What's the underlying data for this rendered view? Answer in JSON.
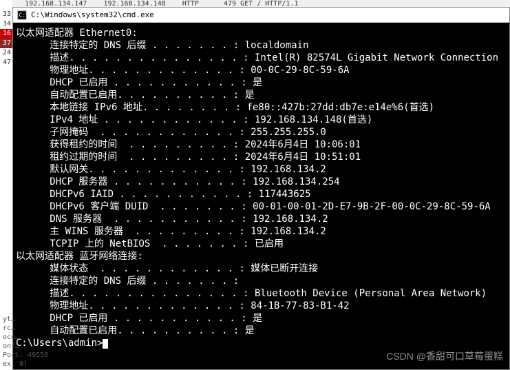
{
  "background": {
    "top_row": "   192.168.134.147    192.168.134.148    HTTP      479 GET / HTTP/1.1",
    "line_numbers": [
      "",
      "33",
      "34",
      "16",
      "37",
      "24",
      "47"
    ],
    "bottom_lines": [
      "yt…",
      "rc…",
      "oco…",
      "onf…",
      "",
      "Port: 49556",
      "ex: 0]"
    ]
  },
  "window": {
    "title": "C:\\Windows\\system32\\cmd.exe"
  },
  "terminal": {
    "adapter1_header": "以太网适配器 Ethernet0:",
    "adapter1": [
      {
        "label": "连接特定的 DNS 后缀",
        "dots": " . . . . . . . :",
        "value": " localdomain"
      },
      {
        "label": "描述",
        "dots": ". . . . . . . . . . . . . . . :",
        "value": " Intel(R) 82574L Gigabit Network Connection"
      },
      {
        "label": "物理地址",
        "dots": ". . . . . . . . . . . . . :",
        "value": " 00-0C-29-8C-59-6A"
      },
      {
        "label": "DHCP 已启用",
        "dots": " . . . . . . . . . . . :",
        "value": " 是"
      },
      {
        "label": "自动配置已启用",
        "dots": ". . . . . . . . . . :",
        "value": " 是"
      },
      {
        "label": "本地链接 IPv6 地址",
        "dots": ". . . . . . . . :",
        "value": " fe80::427b:27dd:db7e:e14e%6(首选)"
      },
      {
        "label": "IPv4 地址",
        "dots": " . . . . . . . . . . . . :",
        "value": " 192.168.134.148(首选)"
      },
      {
        "label": "子网掩码",
        "dots": "  . . . . . . . . . . . . :",
        "value": " 255.255.255.0"
      },
      {
        "label": "获得租约的时间",
        "dots": "  . . . . . . . . . :",
        "value": " 2024年6月4日 10:06:01"
      },
      {
        "label": "租约过期的时间",
        "dots": "  . . . . . . . . . :",
        "value": " 2024年6月4日 10:51:01"
      },
      {
        "label": "默认网关",
        "dots": ". . . . . . . . . . . . . :",
        "value": " 192.168.134.2"
      },
      {
        "label": "DHCP 服务器",
        "dots": " . . . . . . . . . . . :",
        "value": " 192.168.134.254"
      },
      {
        "label": "DHCPv6 IAID",
        "dots": " . . . . . . . . . . . :",
        "value": " 117443625"
      },
      {
        "label": "DHCPv6 客户端 DUID",
        "dots": "  . . . . . . . :",
        "value": " 00-01-00-01-2D-E7-9B-2F-00-0C-29-8C-59-6A"
      },
      {
        "label": "DNS 服务器",
        "dots": "  . . . . . . . . . . . :",
        "value": " 192.168.134.2"
      },
      {
        "label": "主 WINS 服务器",
        "dots": "  . . . . . . . . . :",
        "value": " 192.168.134.2"
      },
      {
        "label": "TCPIP 上的 NetBIOS",
        "dots": "  . . . . . . . :",
        "value": " 已启用"
      }
    ],
    "adapter2_header": "以太网适配器 蓝牙网络连接:",
    "adapter2": [
      {
        "label": "媒体状态",
        "dots": "  . . . . . . . . . . . . :",
        "value": " 媒体已断开连接"
      },
      {
        "label": "连接特定的 DNS 后缀",
        "dots": " . . . . . . . :",
        "value": ""
      },
      {
        "label": "描述",
        "dots": ". . . . . . . . . . . . . . . :",
        "value": " Bluetooth Device (Personal Area Network)"
      },
      {
        "label": "物理地址",
        "dots": ". . . . . . . . . . . . . :",
        "value": " 84-1B-77-83-B1-42"
      },
      {
        "label": "DHCP 已启用",
        "dots": " . . . . . . . . . . . :",
        "value": " 是"
      },
      {
        "label": "自动配置已启用",
        "dots": ". . . . . . . . . . :",
        "value": " 是"
      }
    ],
    "prompt": "C:\\Users\\admin>"
  },
  "watermark": "CSDN @香甜可口草莓蛋糕"
}
